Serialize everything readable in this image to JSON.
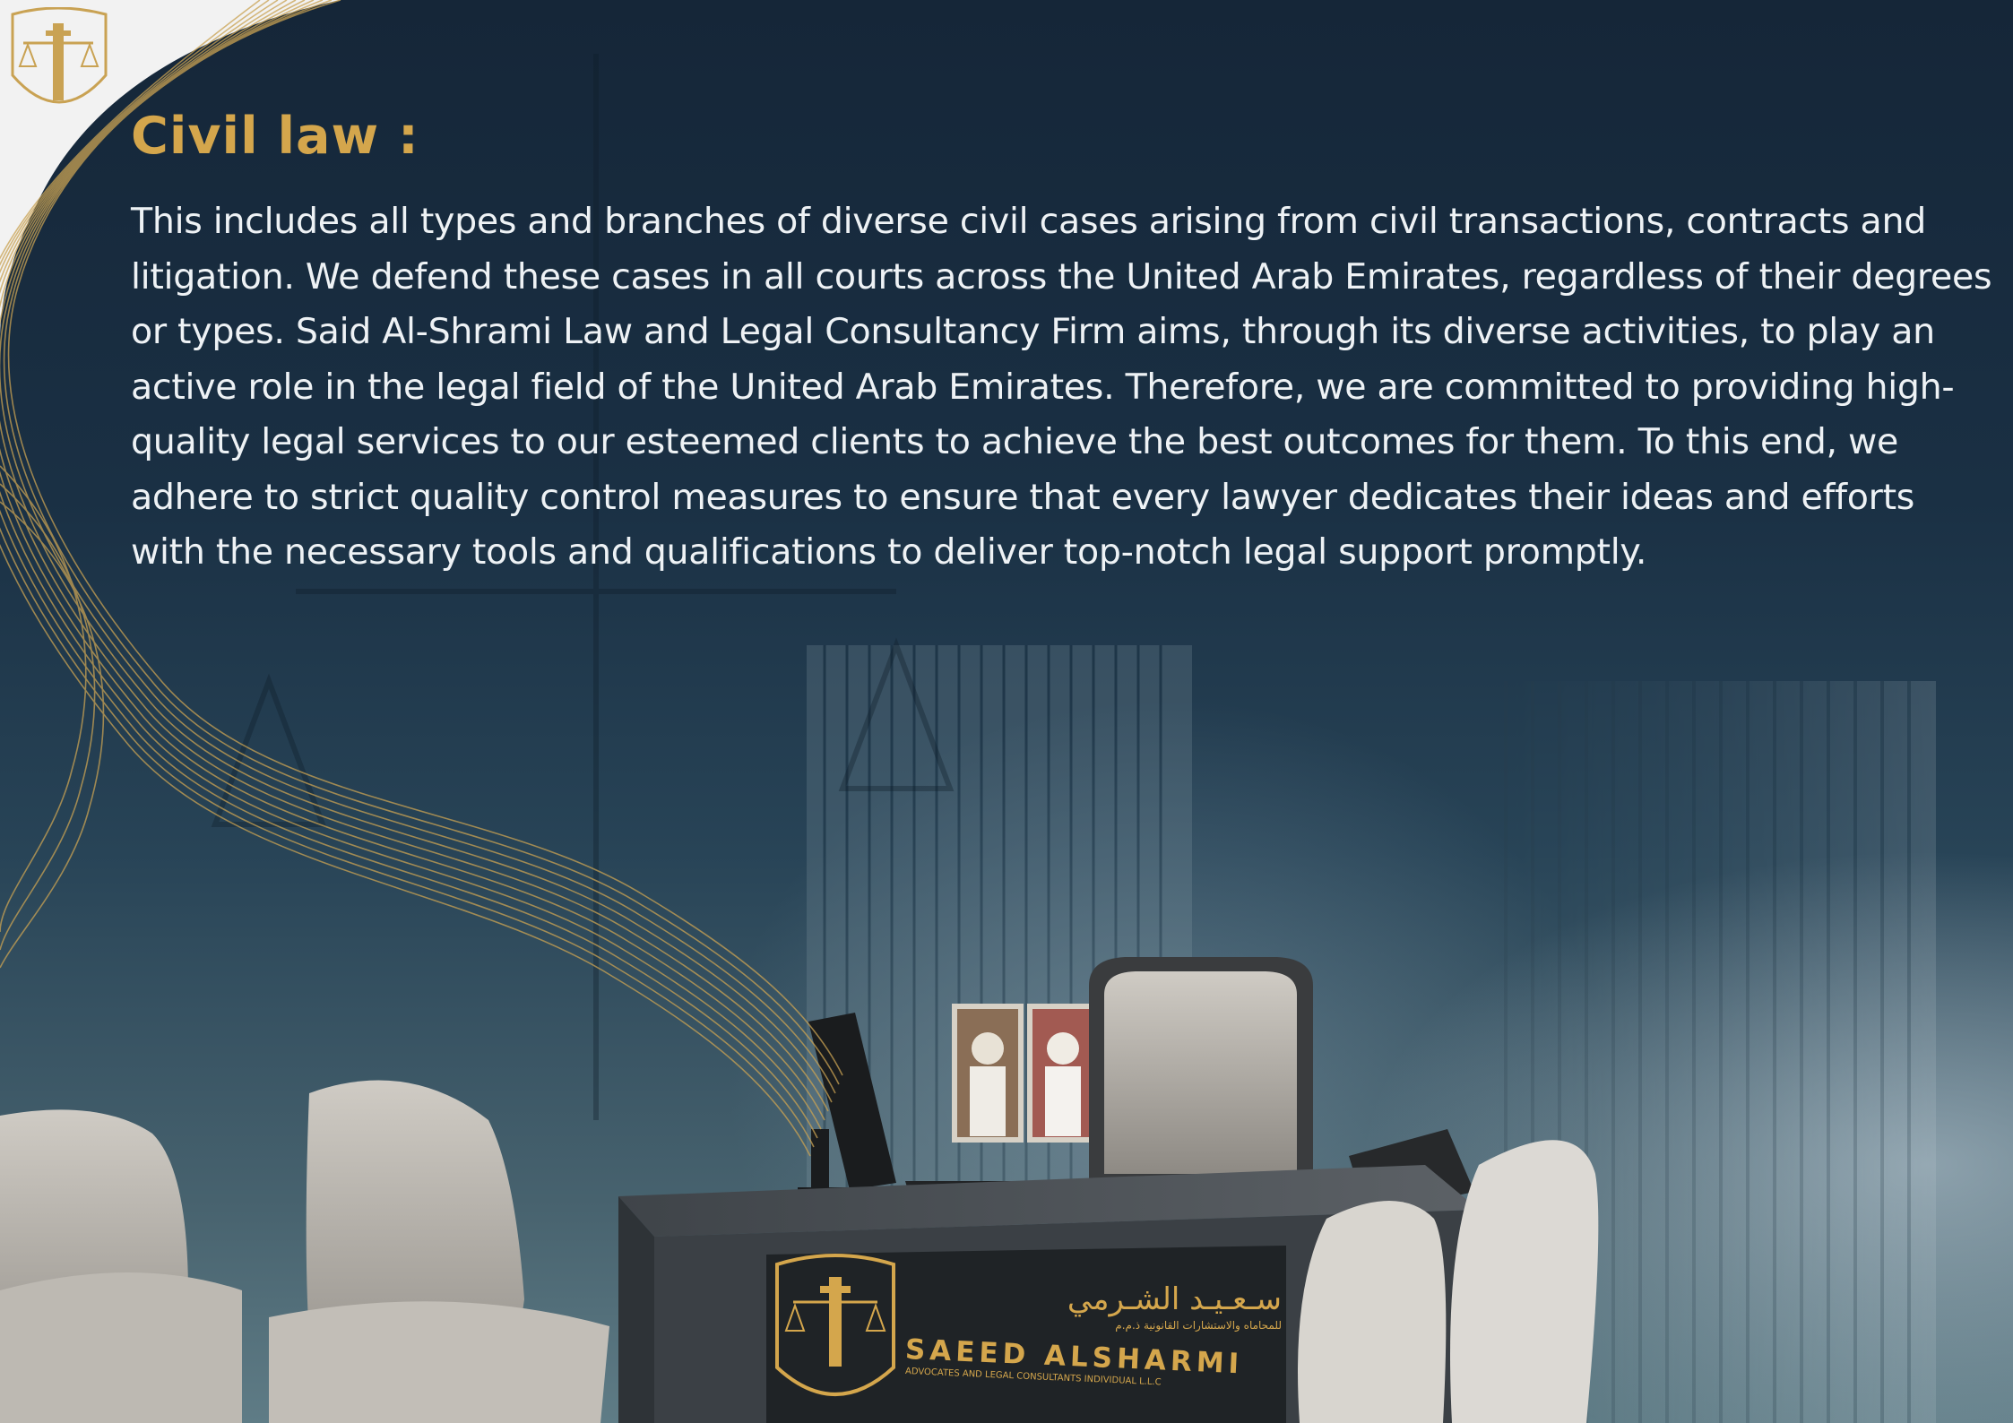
{
  "section": {
    "title": "Civil law :",
    "body": "This includes all types and branches of diverse civil cases arising from civil transactions, contracts and litigation. We defend these cases in all courts across the United Arab Emirates, regardless of their degrees or types. Said Al-Shrami Law and Legal Consultancy Firm aims, through its diverse activities, to play an active role in the legal field of the United Arab Emirates. Therefore, we are committed to providing high-quality legal services to our esteemed clients to achieve the best outcomes for them. To this end, we adhere to strict quality control measures to ensure that every lawyer dedicates their ideas and efforts with the necessary tools and qualifications to deliver top-notch legal support promptly."
  },
  "desk_sign": {
    "arabic_name": "سـعـيـد الشـرمي",
    "arabic_sub": "للمحاماه والاستشارات القانونية ذ.م.م",
    "english_name": "SAEED ALSHARMI",
    "english_sub": "ADVOCATES AND LEGAL CONSULTANTS INDIVIDUAL L.L.C"
  },
  "colors": {
    "accent_gold": "#d4a64c",
    "background_navy": "#16283a",
    "text_white": "#eef2f5"
  },
  "icons": {
    "corner_logo": "pillar-scales-logo-icon",
    "desk_logo": "pillar-scales-logo-icon"
  }
}
